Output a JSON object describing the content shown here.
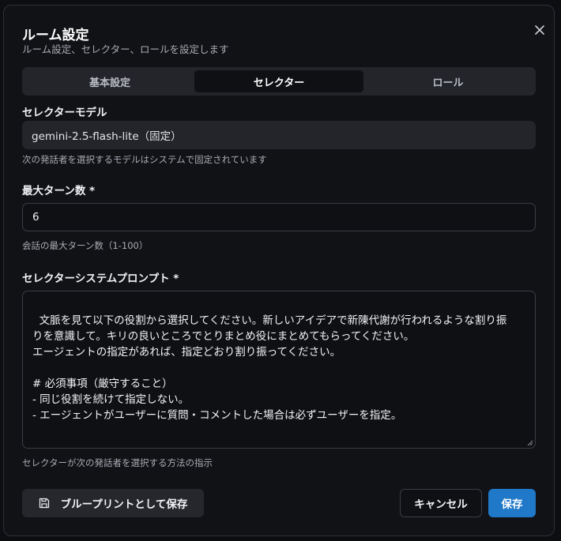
{
  "dialog": {
    "title": "ルーム設定",
    "subtitle": "ルーム設定、セレクター、ロールを設定します",
    "close_icon": "close-icon"
  },
  "tabs": [
    {
      "label": "基本設定",
      "active": false
    },
    {
      "label": "セレクター",
      "active": true
    },
    {
      "label": "ロール",
      "active": false
    }
  ],
  "selector_model": {
    "label": "セレクターモデル",
    "value": "gemini-2.5-flash-lite（固定）",
    "hint": "次の発話者を選択するモデルはシステムで固定されています"
  },
  "max_turns": {
    "label": "最大ターン数 *",
    "value": "6",
    "hint": "会話の最大ターン数（1-100）"
  },
  "selector_prompt": {
    "label": "セレクターシステムプロンプト *",
    "value": "文脈を見て以下の役割から選択してください。新しいアイデアで新陳代謝が行われるような割り振\nりを意識して。キリの良いところでとりまとめ役にまとめてもらってください。\nエージェントの指定があれば、指定どおり割り振ってください。\n\n# 必須事項（厳守すること）\n- 同じ役割を続けて指定しない。\n- エージェントがユーザーに質問・コメントした場合は必ずユーザーを指定。",
    "hint": "セレクターが次の発話者を選択する方法の指示"
  },
  "buttons": {
    "blueprint_label": "ブループリントとして保存",
    "blueprint_icon": "save-icon",
    "cancel_label": "キャンセル",
    "save_label": "保存"
  },
  "colors": {
    "accent": "#1f78c8",
    "background": "#111216",
    "surface": "#23252b"
  }
}
